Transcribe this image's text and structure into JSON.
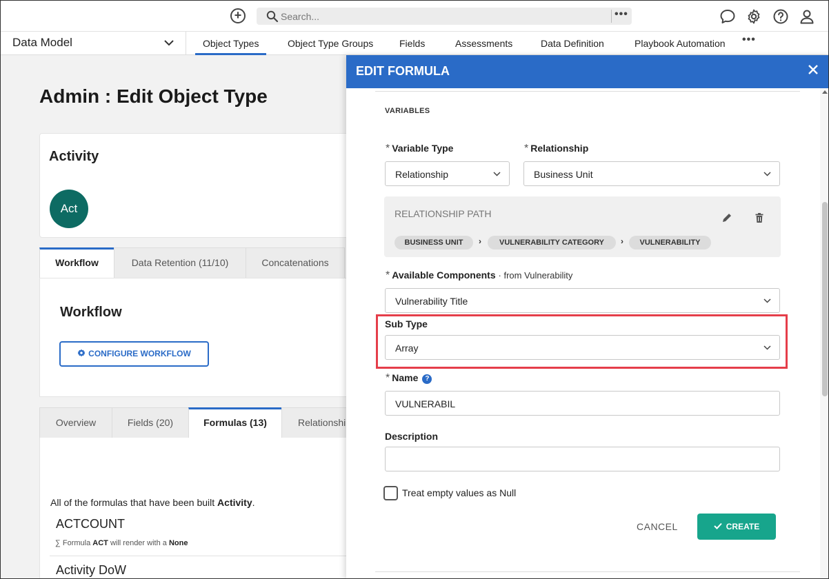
{
  "topbar": {
    "add_label": "+",
    "search_placeholder": "Search...",
    "more_label": "•••"
  },
  "nav": {
    "title": "Data Model",
    "tabs": [
      "Object Types",
      "Object Type Groups",
      "Fields",
      "Assessments",
      "Data Definition",
      "Playbook Automation"
    ],
    "more_label": "•••"
  },
  "page": {
    "title": "Admin : Edit Object Type",
    "object_name": "Activity",
    "avatar_text": "Act",
    "tabs_top": [
      "Workflow",
      "Data Retention (11/10)",
      "Concatenations"
    ],
    "workflow_title": "Workflow",
    "configure_button": "CONFIGURE WORKFLOW",
    "tabs_bottom": [
      "Overview",
      "Fields (20)",
      "Formulas (13)",
      "Relationshi"
    ],
    "intro_prefix": "All of the formulas that have been built ",
    "intro_object": "Activity",
    "intro_suffix": ".",
    "formulas": [
      {
        "name": "ACTCOUNT",
        "desc_prefix": "∑ Formula ",
        "desc_name": "ACT",
        "desc_mid": " will render with a ",
        "desc_value": "None"
      },
      {
        "name": "Activity DoW"
      }
    ]
  },
  "modal": {
    "title": "EDIT FORMULA",
    "section_label": "VARIABLES",
    "variable_type_label": "Variable Type",
    "variable_type_value": "Relationship",
    "relationship_label": "Relationship",
    "relationship_value": "Business Unit",
    "relationship_path_title": "RELATIONSHIP PATH",
    "path": [
      "BUSINESS UNIT",
      "VULNERABILITY CATEGORY",
      "VULNERABILITY"
    ],
    "path_sep": "›",
    "available_components_label": "Available Components",
    "available_components_extra": "· from Vulnerability",
    "available_components_value": "Vulnerability Title",
    "sub_type_label": "Sub Type",
    "sub_type_value": "Array",
    "name_label": "Name",
    "name_help": "?",
    "name_value": "VULNERABIL",
    "description_label": "Description",
    "description_value": "",
    "treat_empty_label": "Treat empty values as Null",
    "cancel_label": "CANCEL",
    "create_label": "CREATE",
    "required_mark": "*"
  },
  "colors": {
    "accent": "#2a6bc7",
    "create": "#17a58c",
    "highlight": "#e53e4a",
    "avatar": "#0d6b63"
  }
}
